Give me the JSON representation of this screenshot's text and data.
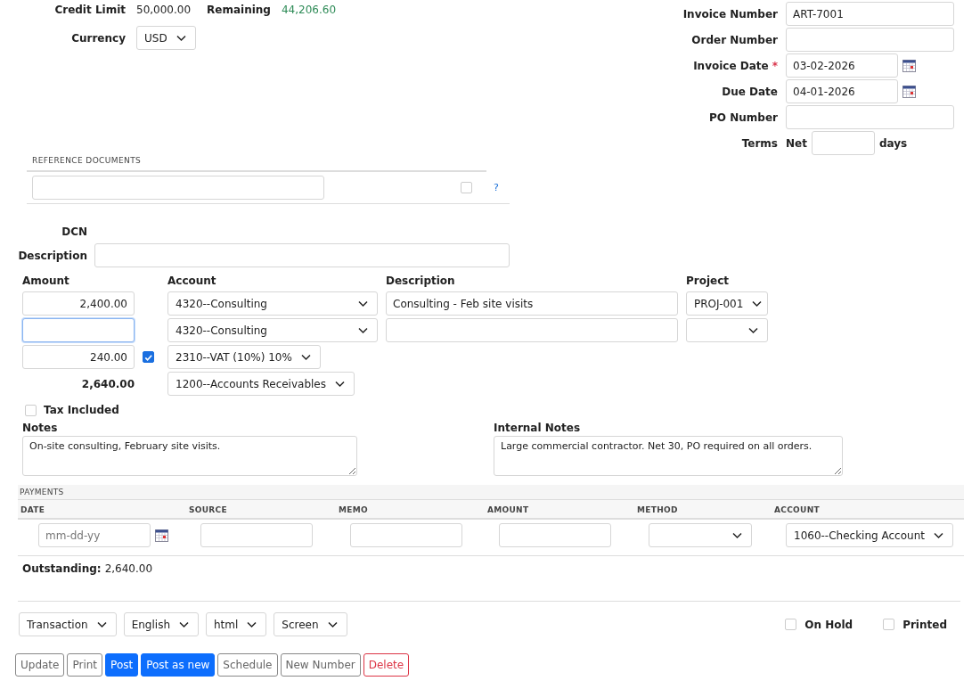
{
  "account_summary": {
    "credit_limit_label": "Credit Limit",
    "credit_limit": "50,000.00",
    "remaining_label": "Remaining",
    "remaining": "44,206.60",
    "currency_label": "Currency",
    "currency": "USD"
  },
  "header_fields": [
    {
      "kind": "text",
      "label": "Invoice Number",
      "value": "ART-7001",
      "required": false
    },
    {
      "kind": "text",
      "label": "Order Number",
      "required": false
    },
    {
      "kind": "date",
      "label": "Invoice Date",
      "required": true,
      "required_mark": "*",
      "value": "03-02-2026"
    },
    {
      "kind": "date",
      "label": "Due Date",
      "required": false,
      "value": "04-01-2026"
    },
    {
      "kind": "text",
      "label": "PO Number",
      "required": false
    },
    {
      "kind": "terms",
      "label": "Terms",
      "required": false,
      "prefix": "Net",
      "suffix": "days"
    }
  ],
  "reference_documents": {
    "title": "REFERENCE DOCUMENTS",
    "checked": false,
    "help": "?"
  },
  "dcn_label": "DCN",
  "description_label": "Description",
  "line_items": {
    "columns": [
      "Amount",
      "Account",
      "Description",
      "Project"
    ],
    "rows": [
      {
        "amount": "2,400.00",
        "focused": false,
        "account": "4320--Consulting",
        "description": "Consulting - Feb site visits",
        "project": "PROJ-001"
      },
      {
        "focused": true,
        "account": "4320--Consulting"
      }
    ],
    "tax": {
      "amount": "240.00",
      "checked": true,
      "account": "2310--VAT (10%) 10%"
    },
    "total": {
      "amount": "2,640.00",
      "account": "1200--Accounts Receivables"
    }
  },
  "tax_included": {
    "label": "Tax Included",
    "checked": false
  },
  "notes": {
    "label": "Notes",
    "value": "On-site consulting, February site visits."
  },
  "internal_notes": {
    "label": "Internal Notes",
    "value": "Large commercial contractor. Net 30, PO required on all orders."
  },
  "payments": {
    "title": "PAYMENTS",
    "columns": [
      "DATE",
      "SOURCE",
      "MEMO",
      "AMOUNT",
      "METHOD",
      "ACCOUNT"
    ],
    "rows": [
      {
        "date_placeholder": "mm-dd-yy",
        "account": "1060--Checking Account"
      }
    ]
  },
  "outstanding": {
    "label": "Outstanding:",
    "value": "2,640.00"
  },
  "print_options": [
    "Transaction",
    "English",
    "html",
    "Screen"
  ],
  "flags": [
    {
      "label": "On Hold",
      "checked": false
    },
    {
      "label": "Printed",
      "checked": false
    }
  ],
  "buttons": [
    {
      "label": "Update",
      "kind": "plain"
    },
    {
      "label": "Print",
      "kind": "plain"
    },
    {
      "label": "Post",
      "kind": "primary"
    },
    {
      "label": "Post as new",
      "kind": "primary"
    },
    {
      "label": "Schedule",
      "kind": "plain"
    },
    {
      "label": "New Number",
      "kind": "plain"
    },
    {
      "label": "Delete",
      "kind": "danger"
    }
  ]
}
